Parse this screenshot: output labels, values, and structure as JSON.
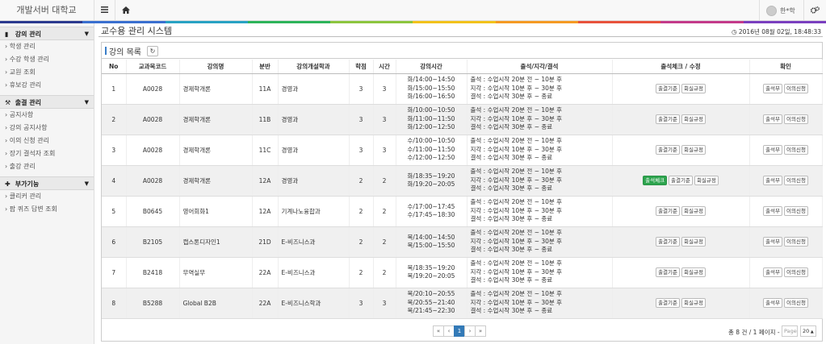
{
  "app": {
    "brand": "개발서버 대학교"
  },
  "header": {
    "user_name": "한*학",
    "accent_colors": [
      "#2b3a8f",
      "#3a6fd0",
      "#28a2c4",
      "#2db45a",
      "#8cc63e",
      "#f2c21b",
      "#f59a23",
      "#e8523c",
      "#c43a8a",
      "#7a3fbf"
    ]
  },
  "sidebar": {
    "sections": [
      {
        "title": "강의 관리",
        "items": [
          "학생 관리",
          "수강 학생 관리",
          "교원 조회",
          "휴보강 관리"
        ]
      },
      {
        "title": "출결 관리",
        "items": [
          "공지사항",
          "강의 공지사항",
          "이의 신청 관리",
          "장기 결석자 조회",
          "출강 관리"
        ]
      },
      {
        "title": "부가기능",
        "items": [
          "클리커 관리",
          "팝 퀴즈 답변 조회"
        ]
      }
    ]
  },
  "main": {
    "title": "교수용 관리 시스템",
    "datetime": "2016년 08월 02일, 18:48:33",
    "panel_title": "강의 목록",
    "columns": [
      "No",
      "교과목코드",
      "강의명",
      "분반",
      "강의개설학과",
      "학점",
      "시간",
      "강의시간",
      "출석/지각/결석",
      "출석체크 / 수정",
      "확인"
    ],
    "attendance_rule": [
      "출석 : 수업시작 20분 전 ~ 10분 후",
      "지각 : 수업시작 10분 후 ~ 30분 후",
      "결석 : 수업시작 30분 후 ~ 종료"
    ],
    "buttons": {
      "check": "출석체크",
      "criteria": "출결기준",
      "regulation": "회실규정",
      "book": "출석부",
      "appeal": "이의신청"
    },
    "rows": [
      {
        "no": "1",
        "code": "A0028",
        "name": "경제학개론",
        "section": "11A",
        "dept": "경영과",
        "credit": "3",
        "hours": "3",
        "times": [
          "화/14:00~14:50",
          "화/15:00~15:50",
          "화/16:00~16:50"
        ],
        "check": false
      },
      {
        "no": "2",
        "code": "A0028",
        "name": "경제학개론",
        "section": "11B",
        "dept": "경영과",
        "credit": "3",
        "hours": "3",
        "times": [
          "화/10:00~10:50",
          "화/11:00~11:50",
          "화/12:00~12:50"
        ],
        "check": false
      },
      {
        "no": "3",
        "code": "A0028",
        "name": "경제학개론",
        "section": "11C",
        "dept": "경영과",
        "credit": "3",
        "hours": "3",
        "times": [
          "수/10:00~10:50",
          "수/11:00~11:50",
          "수/12:00~12:50"
        ],
        "check": false
      },
      {
        "no": "4",
        "code": "A0028",
        "name": "경제학개론",
        "section": "12A",
        "dept": "경영과",
        "credit": "2",
        "hours": "2",
        "times": [
          "화/18:35~19:20",
          "화/19:20~20:05"
        ],
        "check": true
      },
      {
        "no": "5",
        "code": "B0645",
        "name": "영어회화1",
        "section": "12A",
        "dept": "기계나노융합과",
        "credit": "2",
        "hours": "2",
        "times": [
          "수/17:00~17:45",
          "수/17:45~18:30"
        ],
        "check": false
      },
      {
        "no": "6",
        "code": "B2105",
        "name": "캡스톤디자인1",
        "section": "21D",
        "dept": "E-비즈니스과",
        "credit": "2",
        "hours": "2",
        "times": [
          "목/14:00~14:50",
          "목/15:00~15:50"
        ],
        "check": false
      },
      {
        "no": "7",
        "code": "B2418",
        "name": "무역실무",
        "section": "22A",
        "dept": "E-비즈니스과",
        "credit": "2",
        "hours": "2",
        "times": [
          "목/18:35~19:20",
          "목/19:20~20:05"
        ],
        "check": false
      },
      {
        "no": "8",
        "code": "B5288",
        "name": "Global B2B",
        "section": "22A",
        "dept": "E-비즈니스학과",
        "credit": "3",
        "hours": "3",
        "times": [
          "목/20:10~20:55",
          "목/20:55~21:40",
          "목/21:45~22:30"
        ],
        "check": false
      }
    ],
    "pager": {
      "first": "«",
      "prev": "‹",
      "current": "1",
      "next": "›",
      "last": "»"
    },
    "summary": "총 8 건 / 1 페이지 -",
    "page_placeholder": "Page",
    "page_size": "20"
  }
}
